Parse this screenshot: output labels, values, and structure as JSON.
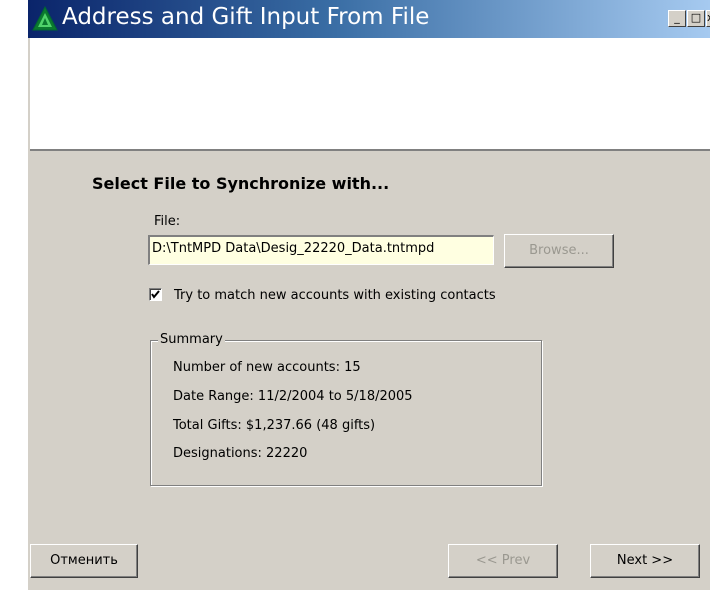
{
  "window": {
    "title": "Address and Gift Input From File",
    "controls": {
      "minimize": "_",
      "maximize": "□",
      "close": "x"
    }
  },
  "section": {
    "heading": "Select File to Synchronize with..."
  },
  "file": {
    "label": "File:",
    "value": "D:\\TntMPD Data\\Desig_22220_Data.tntmpd",
    "browse_label": "Browse..."
  },
  "match_option": {
    "checked": true,
    "label": "Try to match new accounts with existing contacts"
  },
  "summary": {
    "title": "Summary",
    "lines": [
      "Number of new accounts:  15",
      "Date Range:  11/2/2004  to  5/18/2005",
      "Total Gifts:  $1,237.66  (48 gifts)",
      "Designations:  22220"
    ]
  },
  "footer": {
    "cancel_label": "Отменить",
    "prev_label": "<< Prev",
    "next_label": "Next >>"
  },
  "icons": [
    "app-triangle-icon",
    "minimize-icon",
    "maximize-icon",
    "close-icon",
    "checkmark-icon"
  ],
  "colors": {
    "titlebar_start": "#0a246a",
    "titlebar_end": "#a6caf0",
    "face": "#d4d0c8",
    "input_bg": "#ffffe1"
  }
}
